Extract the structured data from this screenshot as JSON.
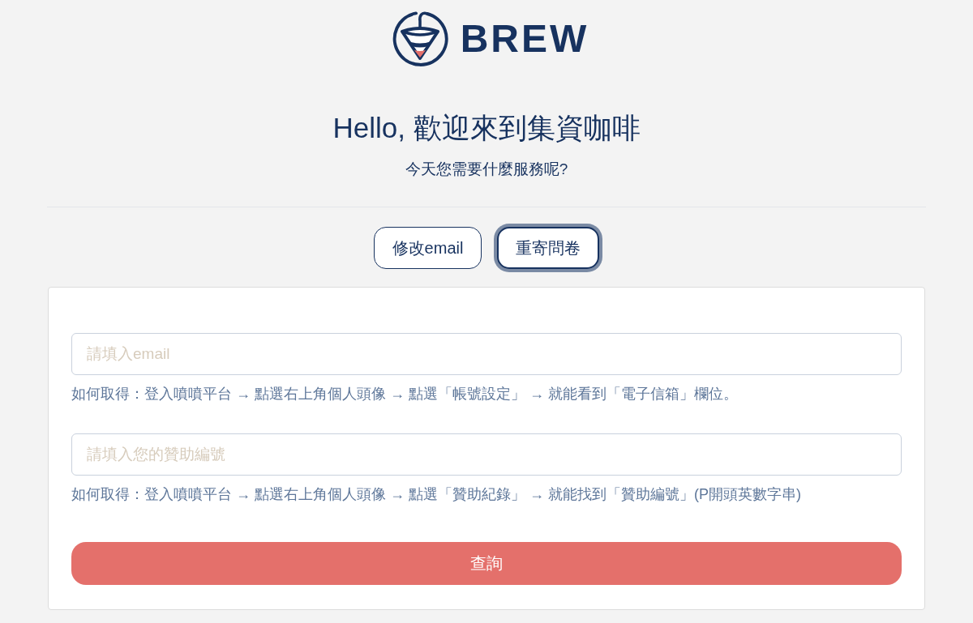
{
  "logo": {
    "text": "BREW"
  },
  "heading": "Hello, 歡迎來到集資咖啡",
  "subheading": "今天您需要什麼服務呢?",
  "tabs": [
    {
      "label": "修改email",
      "selected": false
    },
    {
      "label": "重寄問卷",
      "selected": true
    }
  ],
  "form": {
    "fields": [
      {
        "placeholder": "請填入email",
        "hint": "如何取得：登入噴噴平台 → 點選右上角個人頭像 → 點選「帳號設定」 → 就能看到「電子信箱」欄位。"
      },
      {
        "placeholder": "請填入您的贊助編號",
        "hint": "如何取得：登入噴噴平台 → 點選右上角個人頭像 → 點選「贊助紀錄」 → 就能找到「贊助編號」(P開頭英數字串)"
      }
    ],
    "submit": "查詢"
  }
}
